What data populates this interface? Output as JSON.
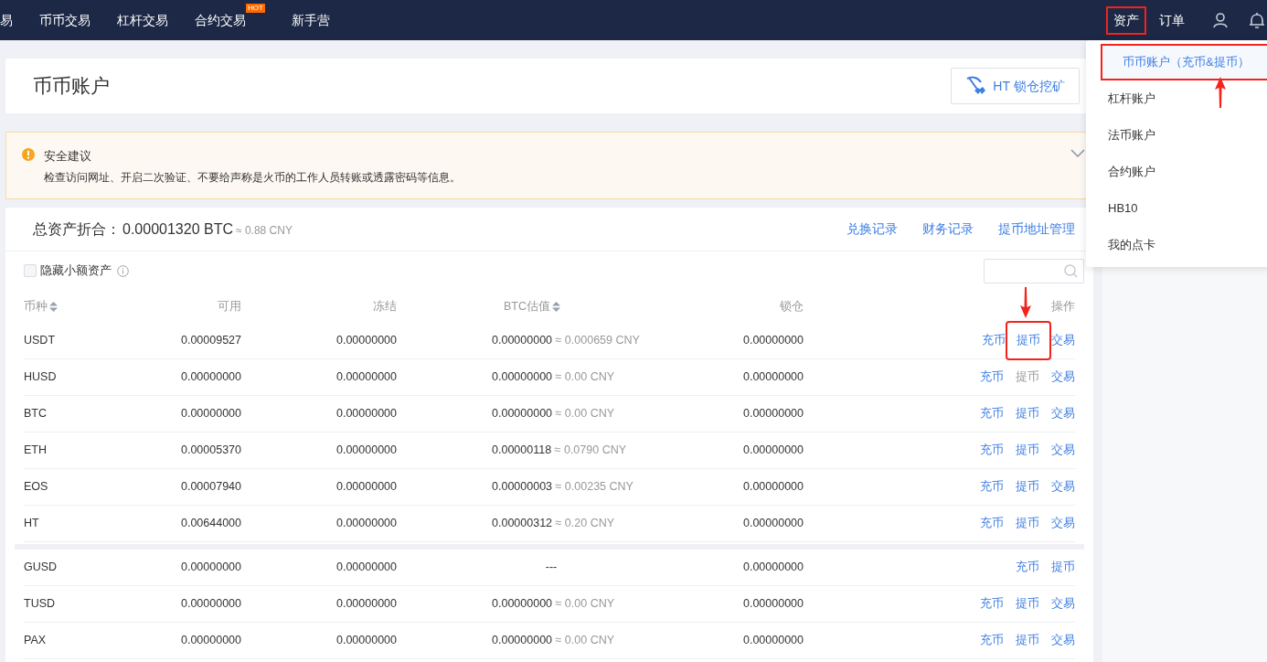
{
  "nav": {
    "items": [
      {
        "label": "易"
      },
      {
        "label": "币币交易"
      },
      {
        "label": "杠杆交易"
      },
      {
        "label": "合约交易",
        "badge": "HOT"
      },
      {
        "label": "新手营"
      }
    ],
    "right_items": [
      {
        "label": "资产",
        "highlighted": true
      },
      {
        "label": "订单",
        "highlighted": false
      }
    ]
  },
  "assets_menu": [
    {
      "label": "币币账户（充币&提币）",
      "selected": true
    },
    {
      "label": "杠杆账户",
      "selected": false
    },
    {
      "label": "法币账户",
      "selected": false
    },
    {
      "label": "合约账户",
      "selected": false
    },
    {
      "label": "HB10",
      "selected": false
    },
    {
      "label": "我的点卡",
      "selected": false
    }
  ],
  "page": {
    "title": "币币账户",
    "mining_button": "HT 锁仓挖矿"
  },
  "alert": {
    "title": "安全建议",
    "message": "检查访问网址、开启二次验证、不要给声称是火币的工作人员转账或透露密码等信息。",
    "expanded": false
  },
  "summary": {
    "label": "总资产折合：",
    "value": "0.00001320 BTC",
    "approx": "≈ 0.88 CNY",
    "links": [
      "兑换记录",
      "财务记录",
      "提币地址管理"
    ]
  },
  "filter": {
    "hide_small": {
      "label": "隐藏小额资产",
      "checked": false
    }
  },
  "table": {
    "columns": [
      {
        "label": "币种",
        "sortable": true
      },
      {
        "label": "可用",
        "sortable": false
      },
      {
        "label": "冻结",
        "sortable": false
      },
      {
        "label": "BTC估值",
        "sortable": true
      },
      {
        "label": "锁仓",
        "sortable": false
      },
      {
        "label": "操作",
        "sortable": false
      }
    ],
    "groups": [
      [
        {
          "coin": "USDT",
          "available": "0.00009527",
          "frozen": "0.00000000",
          "btc": "0.00000000",
          "cny": "≈ 0.000659 CNY",
          "locked": "0.00000000",
          "actions": [
            {
              "label": "充币",
              "disabled": false,
              "highlighted": false
            },
            {
              "label": "提币",
              "disabled": false,
              "highlighted": true
            },
            {
              "label": "交易",
              "disabled": false,
              "highlighted": false
            }
          ]
        },
        {
          "coin": "HUSD",
          "available": "0.00000000",
          "frozen": "0.00000000",
          "btc": "0.00000000",
          "cny": "≈ 0.00 CNY",
          "locked": "0.00000000",
          "actions": [
            {
              "label": "充币",
              "disabled": false,
              "highlighted": false
            },
            {
              "label": "提币",
              "disabled": true,
              "highlighted": false
            },
            {
              "label": "交易",
              "disabled": false,
              "highlighted": false
            }
          ]
        },
        {
          "coin": "BTC",
          "available": "0.00000000",
          "frozen": "0.00000000",
          "btc": "0.00000000",
          "cny": "≈ 0.00 CNY",
          "locked": "0.00000000",
          "actions": [
            {
              "label": "充币",
              "disabled": false,
              "highlighted": false
            },
            {
              "label": "提币",
              "disabled": false,
              "highlighted": false
            },
            {
              "label": "交易",
              "disabled": false,
              "highlighted": false
            }
          ]
        },
        {
          "coin": "ETH",
          "available": "0.00005370",
          "frozen": "0.00000000",
          "btc": "0.00000118",
          "cny": "≈ 0.0790 CNY",
          "locked": "0.00000000",
          "actions": [
            {
              "label": "充币",
              "disabled": false,
              "highlighted": false
            },
            {
              "label": "提币",
              "disabled": false,
              "highlighted": false
            },
            {
              "label": "交易",
              "disabled": false,
              "highlighted": false
            }
          ]
        },
        {
          "coin": "EOS",
          "available": "0.00007940",
          "frozen": "0.00000000",
          "btc": "0.00000003",
          "cny": "≈ 0.00235 CNY",
          "locked": "0.00000000",
          "actions": [
            {
              "label": "充币",
              "disabled": false,
              "highlighted": false
            },
            {
              "label": "提币",
              "disabled": false,
              "highlighted": false
            },
            {
              "label": "交易",
              "disabled": false,
              "highlighted": false
            }
          ]
        },
        {
          "coin": "HT",
          "available": "0.00644000",
          "frozen": "0.00000000",
          "btc": "0.00000312",
          "cny": "≈ 0.20 CNY",
          "locked": "0.00000000",
          "actions": [
            {
              "label": "充币",
              "disabled": false,
              "highlighted": false
            },
            {
              "label": "提币",
              "disabled": false,
              "highlighted": false
            },
            {
              "label": "交易",
              "disabled": false,
              "highlighted": false
            }
          ]
        }
      ],
      [
        {
          "coin": "GUSD",
          "available": "0.00000000",
          "frozen": "0.00000000",
          "btc": "---",
          "locked": "0.00000000",
          "actions": [
            {
              "label": "充币",
              "disabled": false,
              "highlighted": false
            },
            {
              "label": "提币",
              "disabled": false,
              "highlighted": false
            }
          ]
        },
        {
          "coin": "TUSD",
          "available": "0.00000000",
          "frozen": "0.00000000",
          "btc": "0.00000000",
          "cny": "≈ 0.00 CNY",
          "locked": "0.00000000",
          "actions": [
            {
              "label": "充币",
              "disabled": false,
              "highlighted": false
            },
            {
              "label": "提币",
              "disabled": false,
              "highlighted": false
            },
            {
              "label": "交易",
              "disabled": false,
              "highlighted": false
            }
          ]
        },
        {
          "coin": "PAX",
          "available": "0.00000000",
          "frozen": "0.00000000",
          "btc": "0.00000000",
          "cny": "≈ 0.00 CNY",
          "locked": "0.00000000",
          "actions": [
            {
              "label": "充币",
              "disabled": false,
              "highlighted": false
            },
            {
              "label": "提币",
              "disabled": false,
              "highlighted": false
            },
            {
              "label": "交易",
              "disabled": false,
              "highlighted": false
            }
          ]
        }
      ]
    ]
  }
}
